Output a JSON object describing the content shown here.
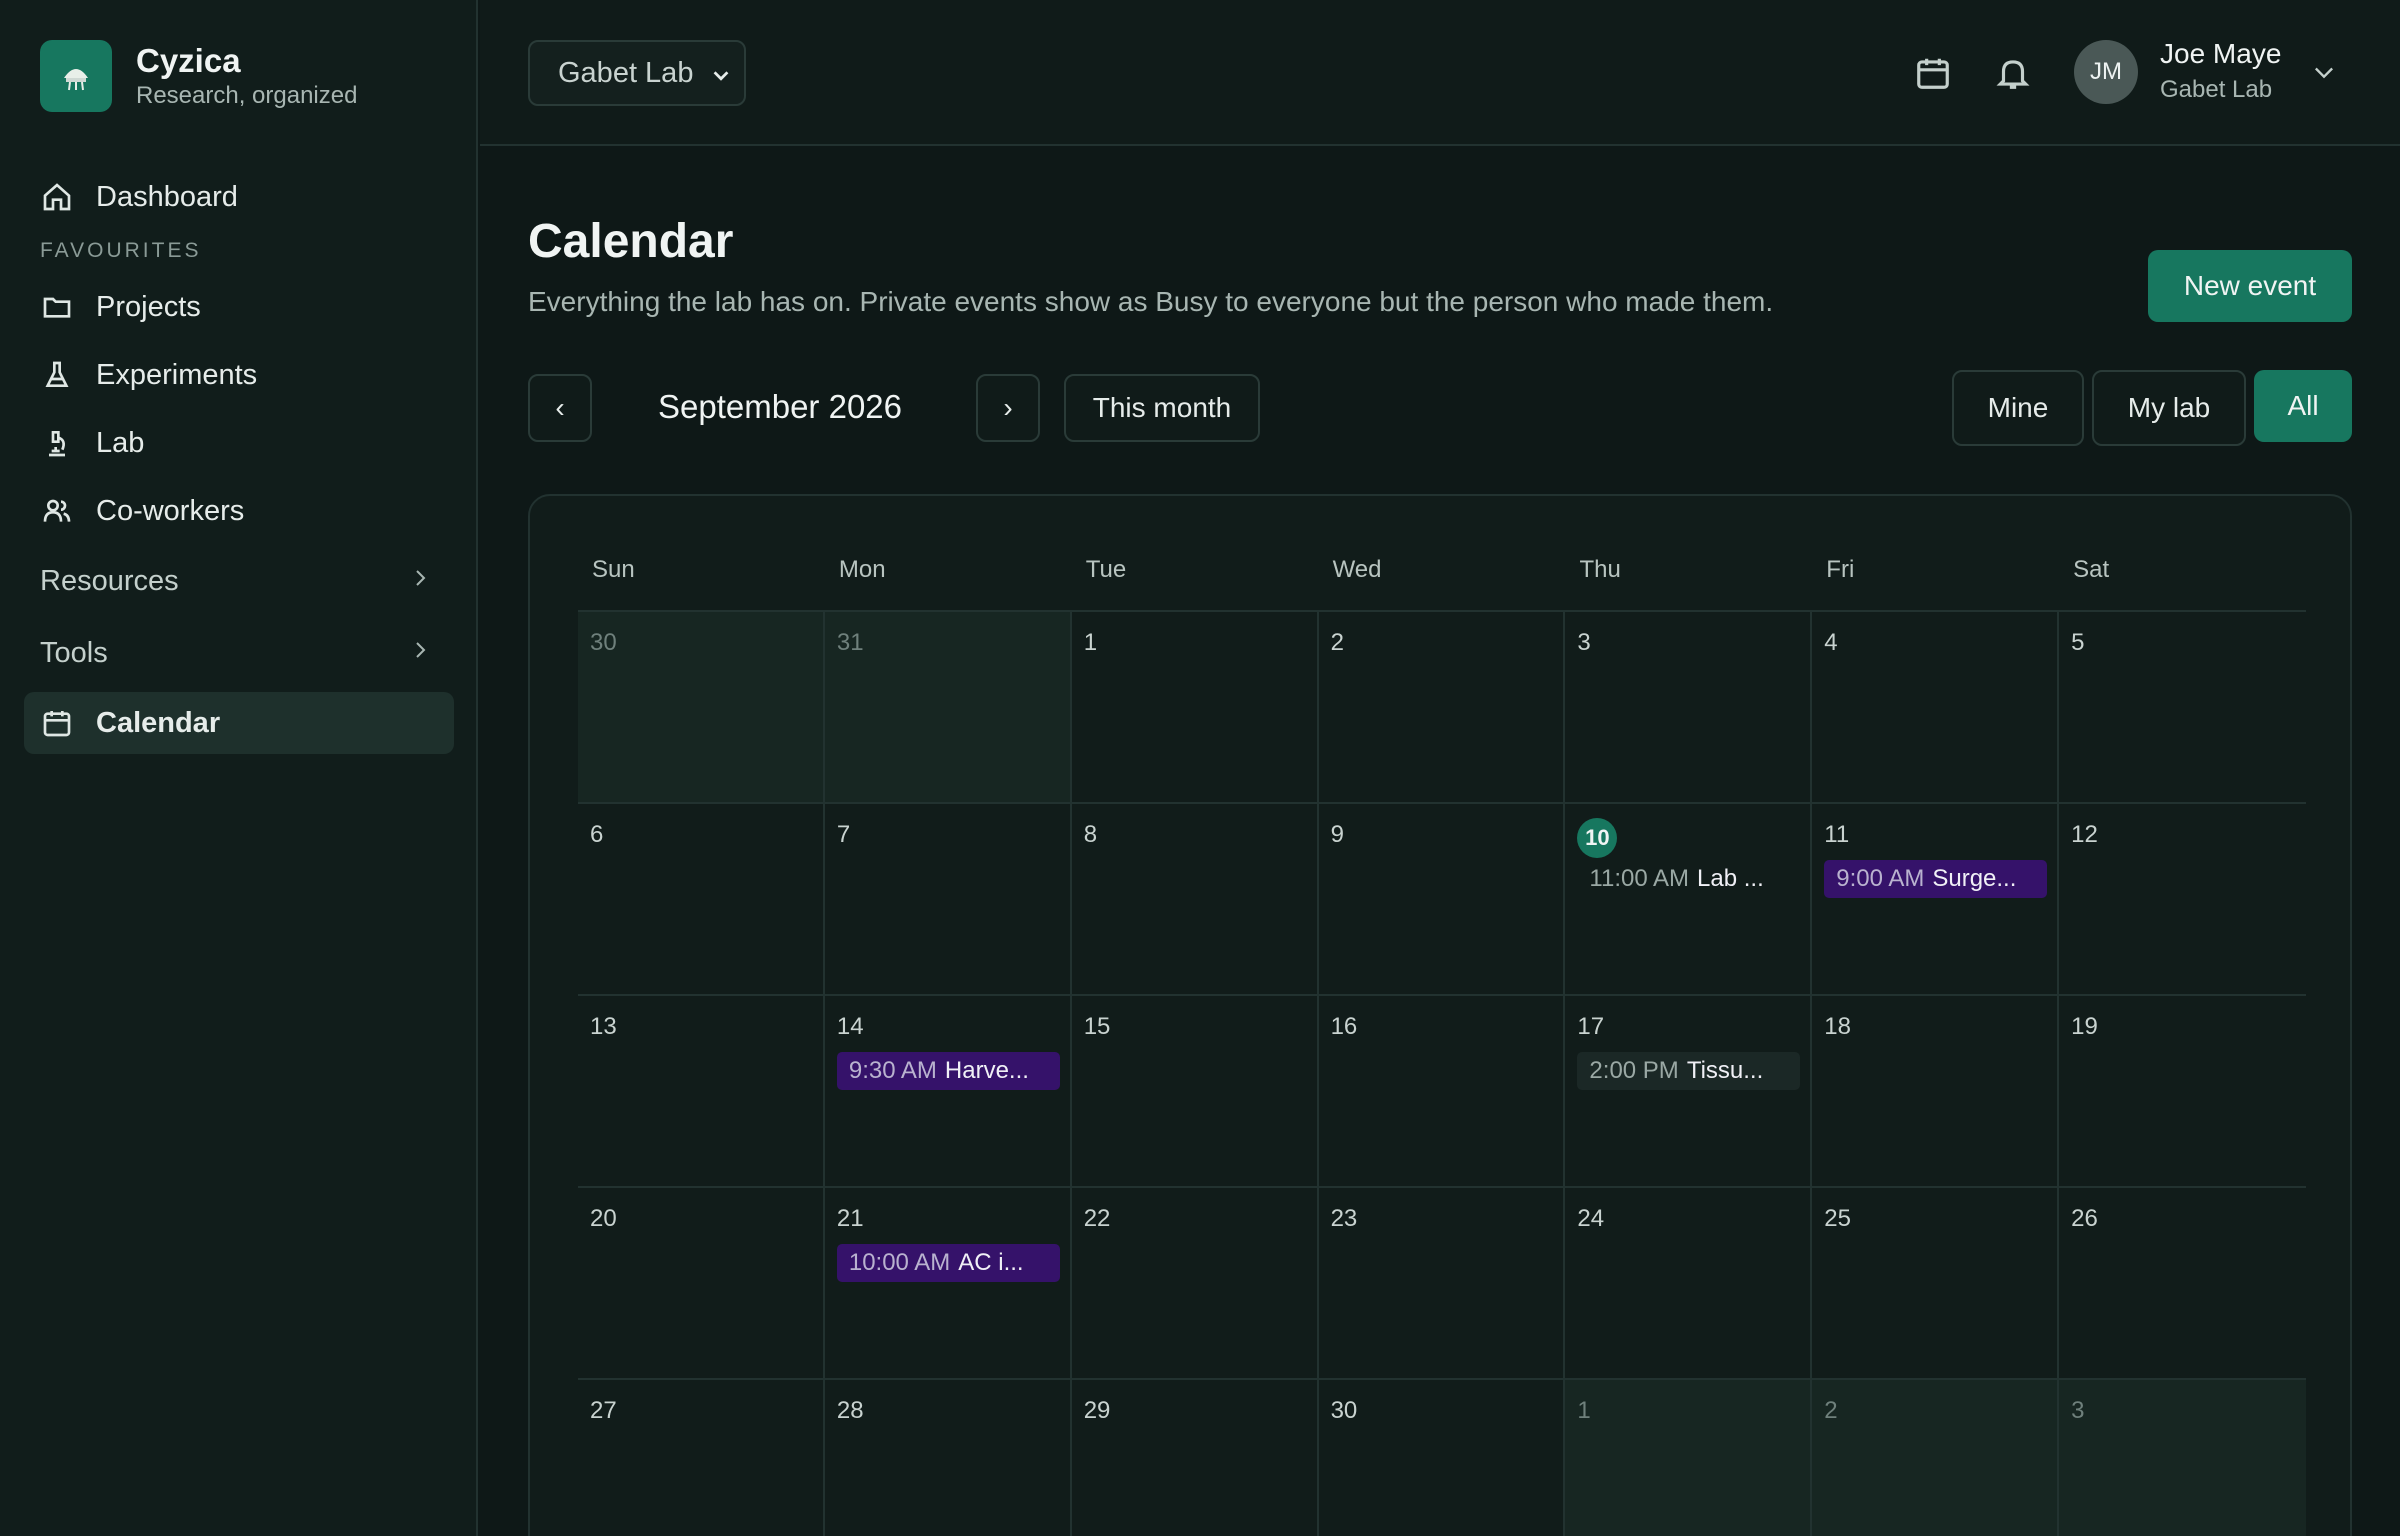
{
  "brand": {
    "name": "Cyzica",
    "tagline": "Research, organized"
  },
  "nav": {
    "dashboard": "Dashboard",
    "favourites_heading": "FAVOURITES",
    "projects": "Projects",
    "experiments": "Experiments",
    "lab": "Lab",
    "coworkers": "Co-workers",
    "resources": "Resources",
    "tools": "Tools",
    "calendar": "Calendar"
  },
  "topbar": {
    "lab_select": "Gabet Lab",
    "user_initials": "JM",
    "user_name": "Joe Maye",
    "user_lab": "Gabet Lab"
  },
  "page": {
    "title": "Calendar",
    "subtitle": "Everything the lab has on. Private events show as Busy to everyone but the person who made them.",
    "new_event": "New event"
  },
  "controls": {
    "prev": "‹",
    "next": "›",
    "month": "September 2026",
    "this_month": "This month",
    "filters": {
      "mine": "Mine",
      "my_lab": "My lab",
      "all": "All"
    },
    "active_filter": "All"
  },
  "calendar": {
    "weekdays": [
      "Sun",
      "Mon",
      "Tue",
      "Wed",
      "Thu",
      "Fri",
      "Sat"
    ],
    "today": "10",
    "days": [
      {
        "n": "30",
        "out": true,
        "events": []
      },
      {
        "n": "31",
        "out": true,
        "events": []
      },
      {
        "n": "1",
        "events": []
      },
      {
        "n": "2",
        "events": []
      },
      {
        "n": "3",
        "events": []
      },
      {
        "n": "4",
        "events": []
      },
      {
        "n": "5",
        "events": []
      },
      {
        "n": "6",
        "events": []
      },
      {
        "n": "7",
        "events": []
      },
      {
        "n": "8",
        "events": []
      },
      {
        "n": "9",
        "events": []
      },
      {
        "n": "10",
        "today": true,
        "events": [
          {
            "time": "11:00 AM",
            "name": "Lab ...",
            "style": "plain"
          }
        ]
      },
      {
        "n": "11",
        "events": [
          {
            "time": "9:00 AM",
            "name": "Surge...",
            "style": "purple"
          }
        ]
      },
      {
        "n": "12",
        "events": []
      },
      {
        "n": "13",
        "events": []
      },
      {
        "n": "14",
        "events": [
          {
            "time": "9:30 AM",
            "name": "Harve...",
            "style": "purple"
          }
        ]
      },
      {
        "n": "15",
        "events": []
      },
      {
        "n": "16",
        "events": []
      },
      {
        "n": "17",
        "events": [
          {
            "time": "2:00 PM",
            "name": "Tissu...",
            "style": "gray"
          }
        ]
      },
      {
        "n": "18",
        "events": []
      },
      {
        "n": "19",
        "events": []
      },
      {
        "n": "20",
        "events": []
      },
      {
        "n": "21",
        "events": [
          {
            "time": "10:00 AM",
            "name": "AC i...",
            "style": "purple"
          }
        ]
      },
      {
        "n": "22",
        "events": []
      },
      {
        "n": "23",
        "events": []
      },
      {
        "n": "24",
        "events": []
      },
      {
        "n": "25",
        "events": []
      },
      {
        "n": "26",
        "events": []
      },
      {
        "n": "27",
        "events": []
      },
      {
        "n": "28",
        "events": []
      },
      {
        "n": "29",
        "events": []
      },
      {
        "n": "30",
        "events": []
      },
      {
        "n": "1",
        "out": true,
        "events": []
      },
      {
        "n": "2",
        "out": true,
        "events": []
      },
      {
        "n": "3",
        "out": true,
        "events": []
      }
    ]
  },
  "colors": {
    "accent": "#17775f",
    "background": "#0e1817",
    "event_purple": "#35126a"
  }
}
